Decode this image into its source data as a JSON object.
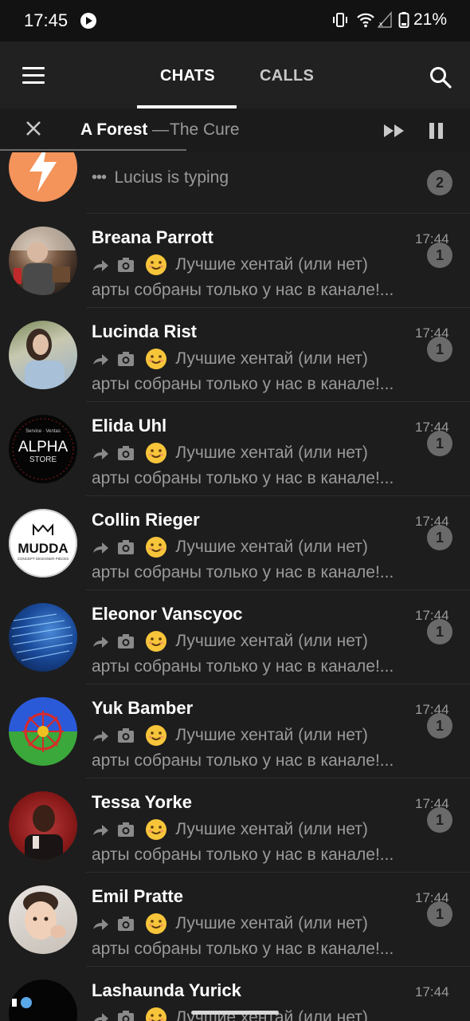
{
  "status_bar": {
    "time": "17:45",
    "battery": "21%"
  },
  "tabs": [
    {
      "label": "CHATS"
    },
    {
      "label": "CALLS"
    }
  ],
  "player": {
    "title": "A Forest",
    "separator": "—",
    "artist": "The Cure"
  },
  "first_chat": {
    "typing_text": "Lucius is typing",
    "unread": "2"
  },
  "chats": [
    {
      "name": "Breana Parrott",
      "time": "17:44",
      "preview_line1": "Лучшие хентай (или нет)",
      "preview_line2": "арты собраны только у нас в канале!...",
      "unread": "1"
    },
    {
      "name": "Lucinda Rist",
      "time": "17:44",
      "preview_line1": "Лучшие хентай (или нет)",
      "preview_line2": "арты собраны только у нас в канале!...",
      "unread": "1"
    },
    {
      "name": "Elida Uhl",
      "time": "17:44",
      "preview_line1": "Лучшие хентай (или нет)",
      "preview_line2": "арты собраны только у нас в канале!...",
      "unread": "1"
    },
    {
      "name": "Collin Rieger",
      "time": "17:44",
      "preview_line1": "Лучшие хентай (или нет)",
      "preview_line2": "арты собраны только у нас в канале!...",
      "unread": "1"
    },
    {
      "name": "Eleonor Vanscyoc",
      "time": "17:44",
      "preview_line1": "Лучшие хентай (или нет)",
      "preview_line2": "арты собраны только у нас в канале!...",
      "unread": "1"
    },
    {
      "name": "Yuk Bamber",
      "time": "17:44",
      "preview_line1": "Лучшие хентай (или нет)",
      "preview_line2": "арты собраны только у нас в канале!...",
      "unread": "1"
    },
    {
      "name": "Tessa Yorke",
      "time": "17:44",
      "preview_line1": "Лучшие хентай (или нет)",
      "preview_line2": "арты собраны только у нас в канале!...",
      "unread": "1"
    },
    {
      "name": "Emil Pratte",
      "time": "17:44",
      "preview_line1": "Лучшие хентай (или нет)",
      "preview_line2": "арты собраны только у нас в канале!...",
      "unread": "1"
    },
    {
      "name": "Lashaunda Yurick",
      "time": "17:44",
      "preview_line1": "Лучшие хентай (или нет)",
      "preview_line2": "",
      "unread": ""
    }
  ],
  "avatar_logos": {
    "alpha_top": "Service · Ventas",
    "alpha_main": "ALPHA",
    "alpha_sub": "STORE",
    "mudda_main": "MUDDA",
    "mudda_sub": "CONCEPT DESIGNER PIECES"
  },
  "icons": [
    "vibrate-icon",
    "wifi-icon",
    "signal-icon",
    "battery-icon",
    "play-icon",
    "menu-icon",
    "search-icon",
    "close-icon",
    "fast-forward-icon",
    "pause-icon",
    "forward-arrow-icon",
    "camera-icon",
    "smiling-emoji-icon"
  ],
  "colors": {
    "background": "#1d1d1d",
    "header": "#212121",
    "secondary_text": "#9a9a9a",
    "badge": "#6a6a6a"
  }
}
